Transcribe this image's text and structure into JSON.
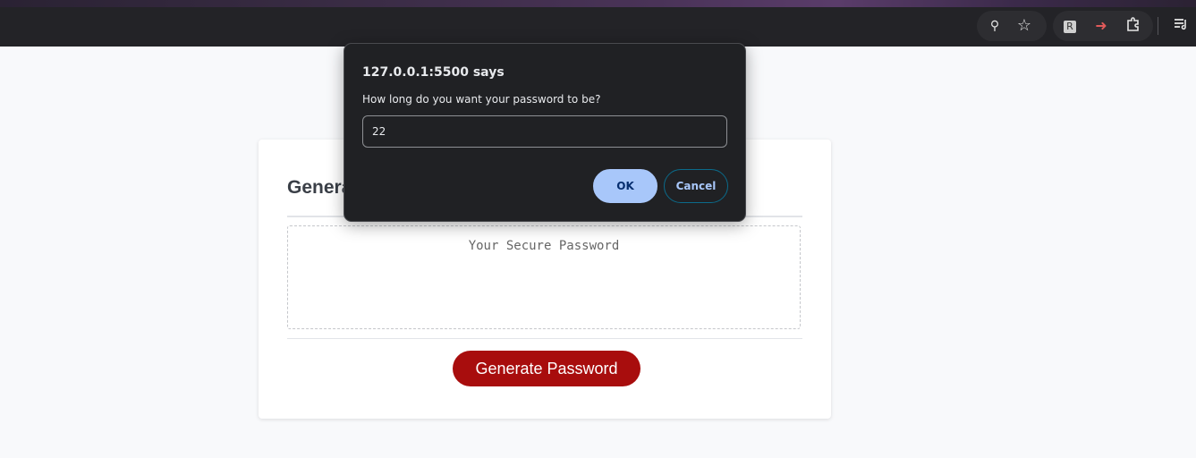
{
  "browser": {
    "toolbar_icons": [
      "zoom-icon",
      "bookmark-star-icon",
      "extension-r-icon",
      "extension-arrow-icon",
      "extensions-puzzle-icon",
      "reading-list-icon"
    ],
    "icon_glyphs": {
      "zoom": "🔍",
      "star": "☆",
      "ext_r": "R",
      "ext_arrow": "➜",
      "puzzle": "⬚",
      "reading_list": "☰"
    }
  },
  "card": {
    "title": "Generate a Password",
    "password_placeholder": "Your Secure Password",
    "generate_button": "Generate Password"
  },
  "dialog": {
    "title": "127.0.0.1:5500 says",
    "message": "How long do you want your password to be?",
    "input_value": "22",
    "ok_label": "OK",
    "cancel_label": "Cancel"
  },
  "colors": {
    "generate_button_bg": "#a80d0d",
    "dialog_bg": "#202124",
    "ok_button_bg": "#a8c7fa"
  }
}
